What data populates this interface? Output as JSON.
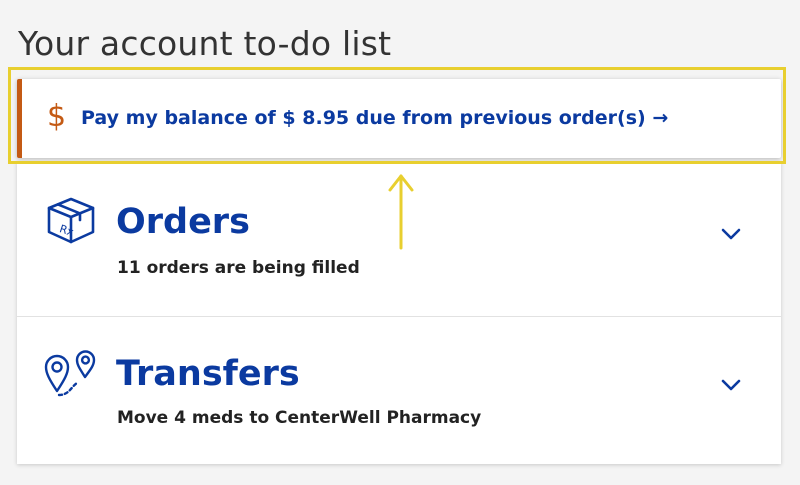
{
  "heading": "Your account to-do list",
  "balance": {
    "icon": "dollar-icon",
    "symbol": "$",
    "link_label": "Pay my balance of $ 8.95 due from previous order(s)",
    "arrow": "→",
    "accent_color": "#c45a14"
  },
  "orders": {
    "icon": "rx-box-icon",
    "title": "Orders",
    "subtitle": "11 orders are being filled"
  },
  "transfers": {
    "icon": "map-pins-icon",
    "title": "Transfers",
    "subtitle": "Move 4 meds to CenterWell Pharmacy"
  },
  "colors": {
    "brand_blue": "#0b3aa0",
    "highlight_yellow": "#e8cf2f"
  }
}
